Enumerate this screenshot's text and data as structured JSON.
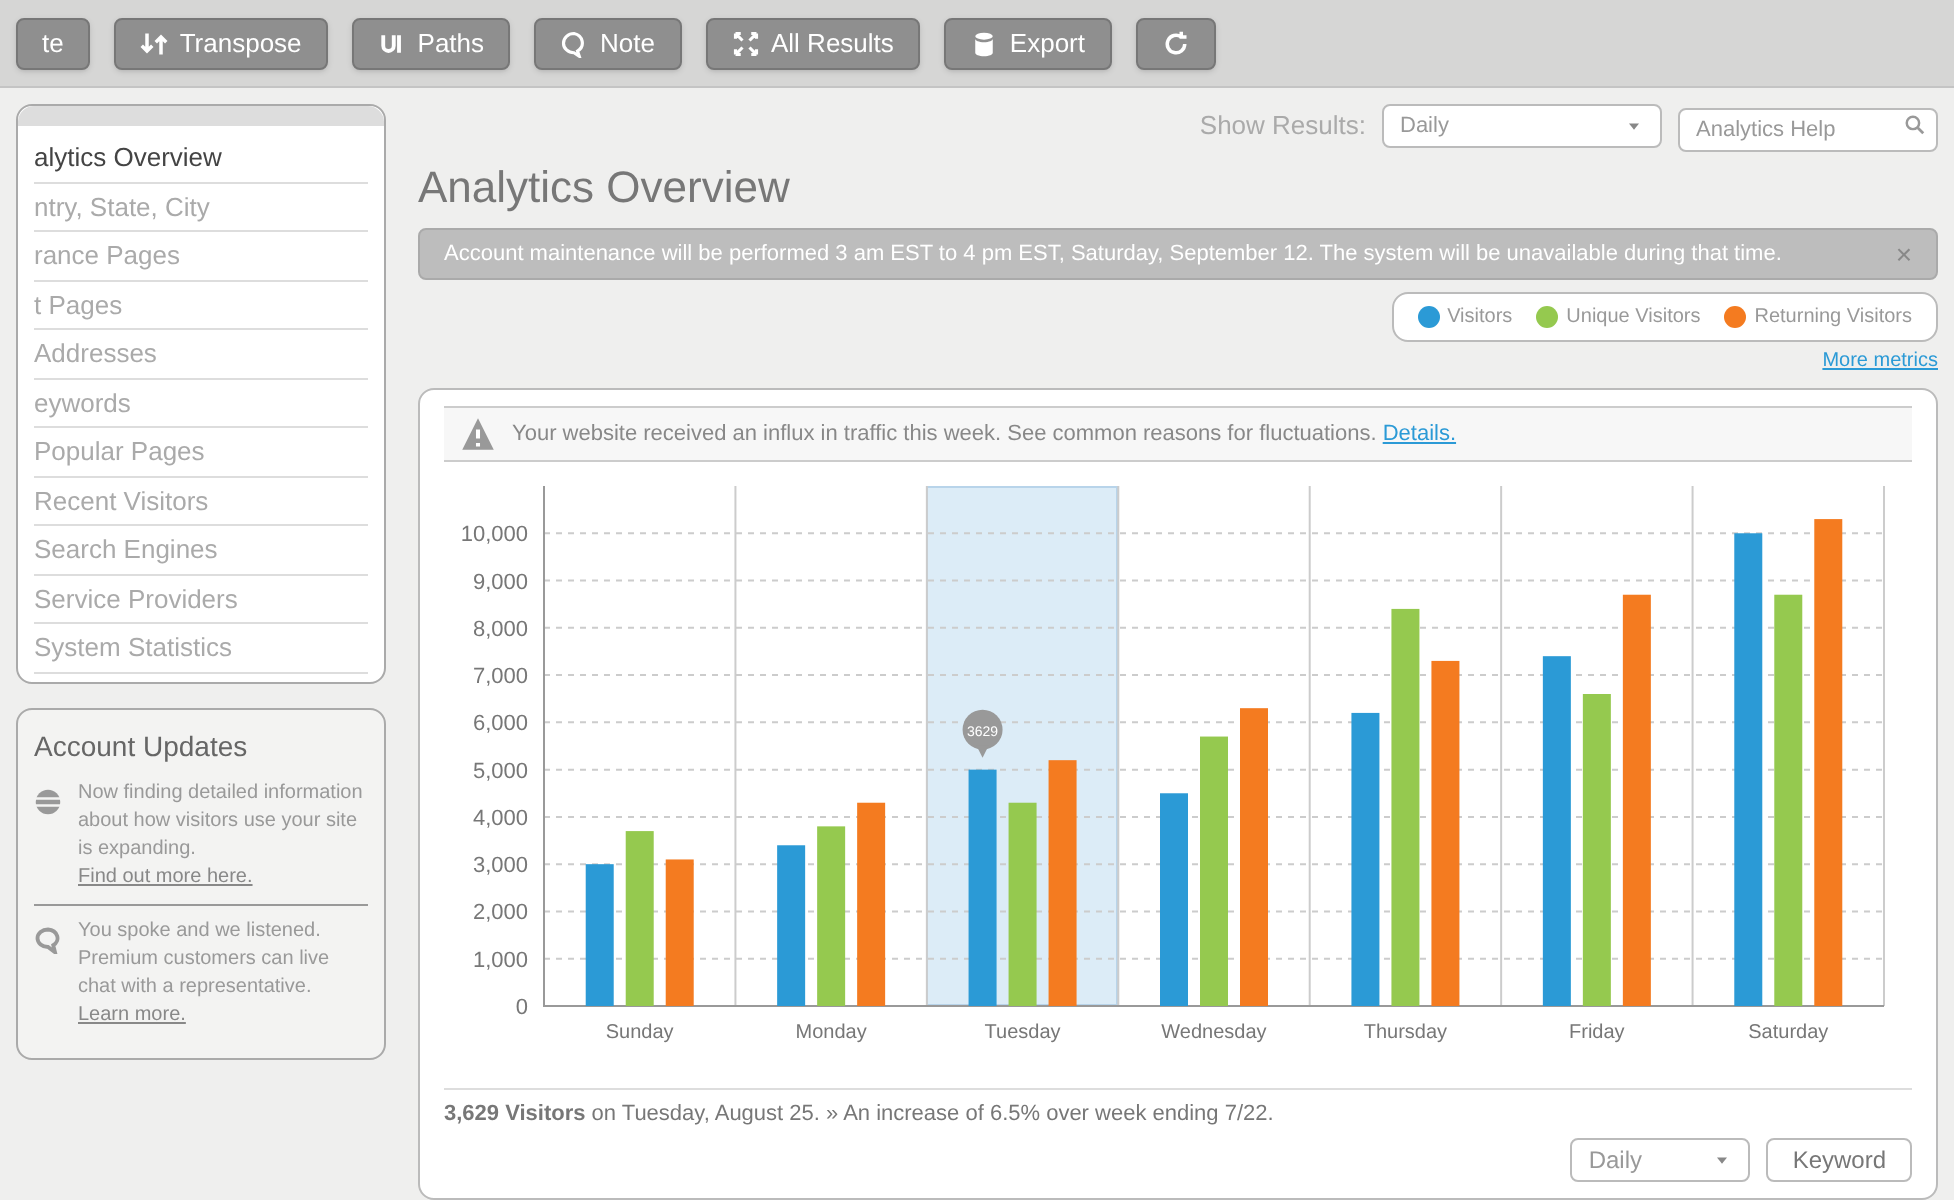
{
  "toolbar": {
    "buttons": [
      {
        "kind": "text",
        "label": "te"
      },
      {
        "kind": "text",
        "label": "Transpose"
      },
      {
        "kind": "text",
        "label": "Paths"
      },
      {
        "kind": "text",
        "label": "Note"
      },
      {
        "kind": "text",
        "label": "All Results"
      },
      {
        "kind": "text",
        "label": "Export"
      },
      {
        "kind": "icon"
      }
    ]
  },
  "show_results": {
    "label": "Show Results:",
    "select": "Daily"
  },
  "help_search": {
    "placeholder": "Analytics Help"
  },
  "banner": {
    "text": "Account maintenance will be performed 3 am EST to 4 pm EST, Saturday, September 12. The system will be unavailable during that time.",
    "close": "×"
  },
  "sidebar": {
    "items": [
      {
        "label": "alytics Overview",
        "selected": true
      },
      {
        "label": "ntry, State, City",
        "selected": false
      },
      {
        "label": "rance Pages",
        "selected": false
      },
      {
        "label": "t Pages",
        "selected": false
      },
      {
        "label": "Addresses",
        "selected": false
      },
      {
        "label": "eywords",
        "selected": false
      },
      {
        "label": "Popular Pages",
        "selected": false
      },
      {
        "label": "Recent Visitors",
        "selected": false
      },
      {
        "label": "Search Engines",
        "selected": false
      },
      {
        "label": "Service Providers",
        "selected": false
      },
      {
        "label": "System Statistics",
        "selected": false
      }
    ]
  },
  "account_updates": {
    "title": "Account Updates",
    "items": [
      {
        "text": "Now finding detailed information about how visitors use your site is expanding.",
        "link": "Find out more here."
      },
      {
        "text": "You spoke and we listened. Premium customers can live chat with a representative.",
        "link": "Learn more."
      }
    ]
  },
  "title": "Analytics Overview",
  "legend": {
    "more_link": "More metrics"
  },
  "alert": {
    "text": "Your website received an influx in traffic this week. See common reasons for fluctuations.",
    "link": "Details."
  },
  "chart_data": {
    "type": "bar",
    "categories": [
      "Sunday",
      "Monday",
      "Tuesday",
      "Wednesday",
      "Thursday",
      "Friday",
      "Saturday"
    ],
    "series": [
      {
        "name": "Visitors",
        "color": "#2b9ad6",
        "values": [
          3000,
          3400,
          5000,
          4500,
          6200,
          7400,
          10000
        ]
      },
      {
        "name": "Unique Visitors",
        "color": "#95c94f",
        "values": [
          3700,
          3800,
          4300,
          5700,
          8400,
          6600,
          8700
        ]
      },
      {
        "name": "Returning Visitors",
        "color": "#f47b20",
        "values": [
          3100,
          4300,
          5200,
          6300,
          7300,
          8700,
          10300
        ]
      }
    ],
    "ylim": [
      0,
      11000
    ],
    "yticks": [
      {
        "value": 0,
        "label": "0"
      },
      {
        "value": 1000,
        "label": "1,000"
      },
      {
        "value": 2000,
        "label": "2,000"
      },
      {
        "value": 3000,
        "label": "3,000"
      },
      {
        "value": 4000,
        "label": "4,000"
      },
      {
        "value": 5000,
        "label": "5,000"
      },
      {
        "value": 6000,
        "label": "6,000"
      },
      {
        "value": 7000,
        "label": "7,000"
      },
      {
        "value": 8000,
        "label": "8,000"
      },
      {
        "value": 9000,
        "label": "9,000"
      },
      {
        "value": 10000,
        "label": "10,000"
      }
    ],
    "grid": true,
    "annotations": [
      "3629"
    ]
  },
  "chart_columns": [
    {
      "selected": false
    },
    {
      "selected": false
    },
    {
      "selected": true
    },
    {
      "selected": false
    },
    {
      "selected": false
    },
    {
      "selected": false
    },
    {
      "selected": false
    }
  ],
  "summary": "**3,629 Visitors** on Tuesday, August 25. » An increase of 6.5% over week ending 7/22.",
  "bottom_controls": {
    "select": "Daily",
    "button": "Keyword"
  }
}
